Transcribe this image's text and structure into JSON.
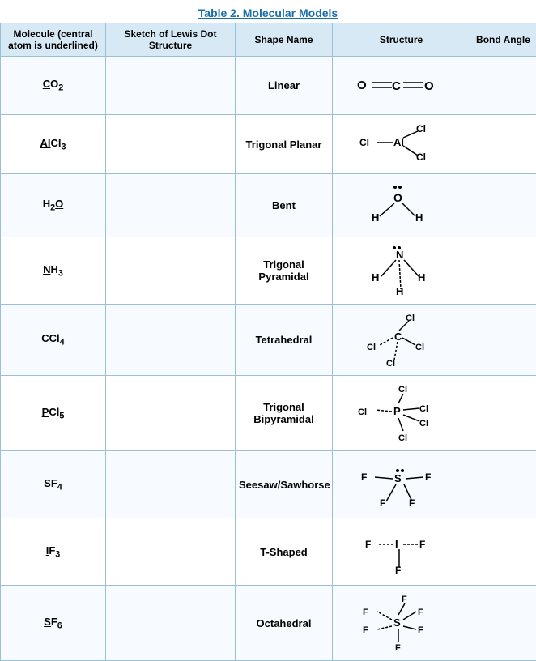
{
  "title": "Table 2. Molecular Models",
  "headers": {
    "molecule": "Molecule (central atom is underlined)",
    "sketch": "Sketch of Lewis Dot Structure",
    "shape": "Shape Name",
    "structure": "Structure",
    "bond": "Bond Angle"
  },
  "rows": [
    {
      "molecule": "CO₂",
      "molecule_underline": "C",
      "shape": "Linear",
      "structure_id": "co2"
    },
    {
      "molecule": "AlCl₃",
      "molecule_underline": "Al",
      "shape": "Trigonal Planar",
      "structure_id": "alcl3"
    },
    {
      "molecule": "H₂O",
      "molecule_underline": "O",
      "shape": "Bent",
      "structure_id": "h2o"
    },
    {
      "molecule": "NH₃",
      "molecule_underline": "N",
      "shape": "Trigonal Pyramidal",
      "structure_id": "nh3"
    },
    {
      "molecule": "CCl₄",
      "molecule_underline": "C",
      "shape": "Tetrahedral",
      "structure_id": "ccl4"
    },
    {
      "molecule": "PCl₅",
      "molecule_underline": "P",
      "shape": "Trigonal Bipyramidal",
      "structure_id": "pcl5"
    },
    {
      "molecule": "SF₄",
      "molecule_underline": "S",
      "shape": "Seesaw/Sawhorse",
      "structure_id": "sf4"
    },
    {
      "molecule": "IF₃",
      "molecule_underline": "I",
      "shape": "T-Shaped",
      "structure_id": "if3"
    },
    {
      "molecule": "SF₆",
      "molecule_underline": "S",
      "shape": "Octahedral",
      "structure_id": "sf6"
    }
  ]
}
